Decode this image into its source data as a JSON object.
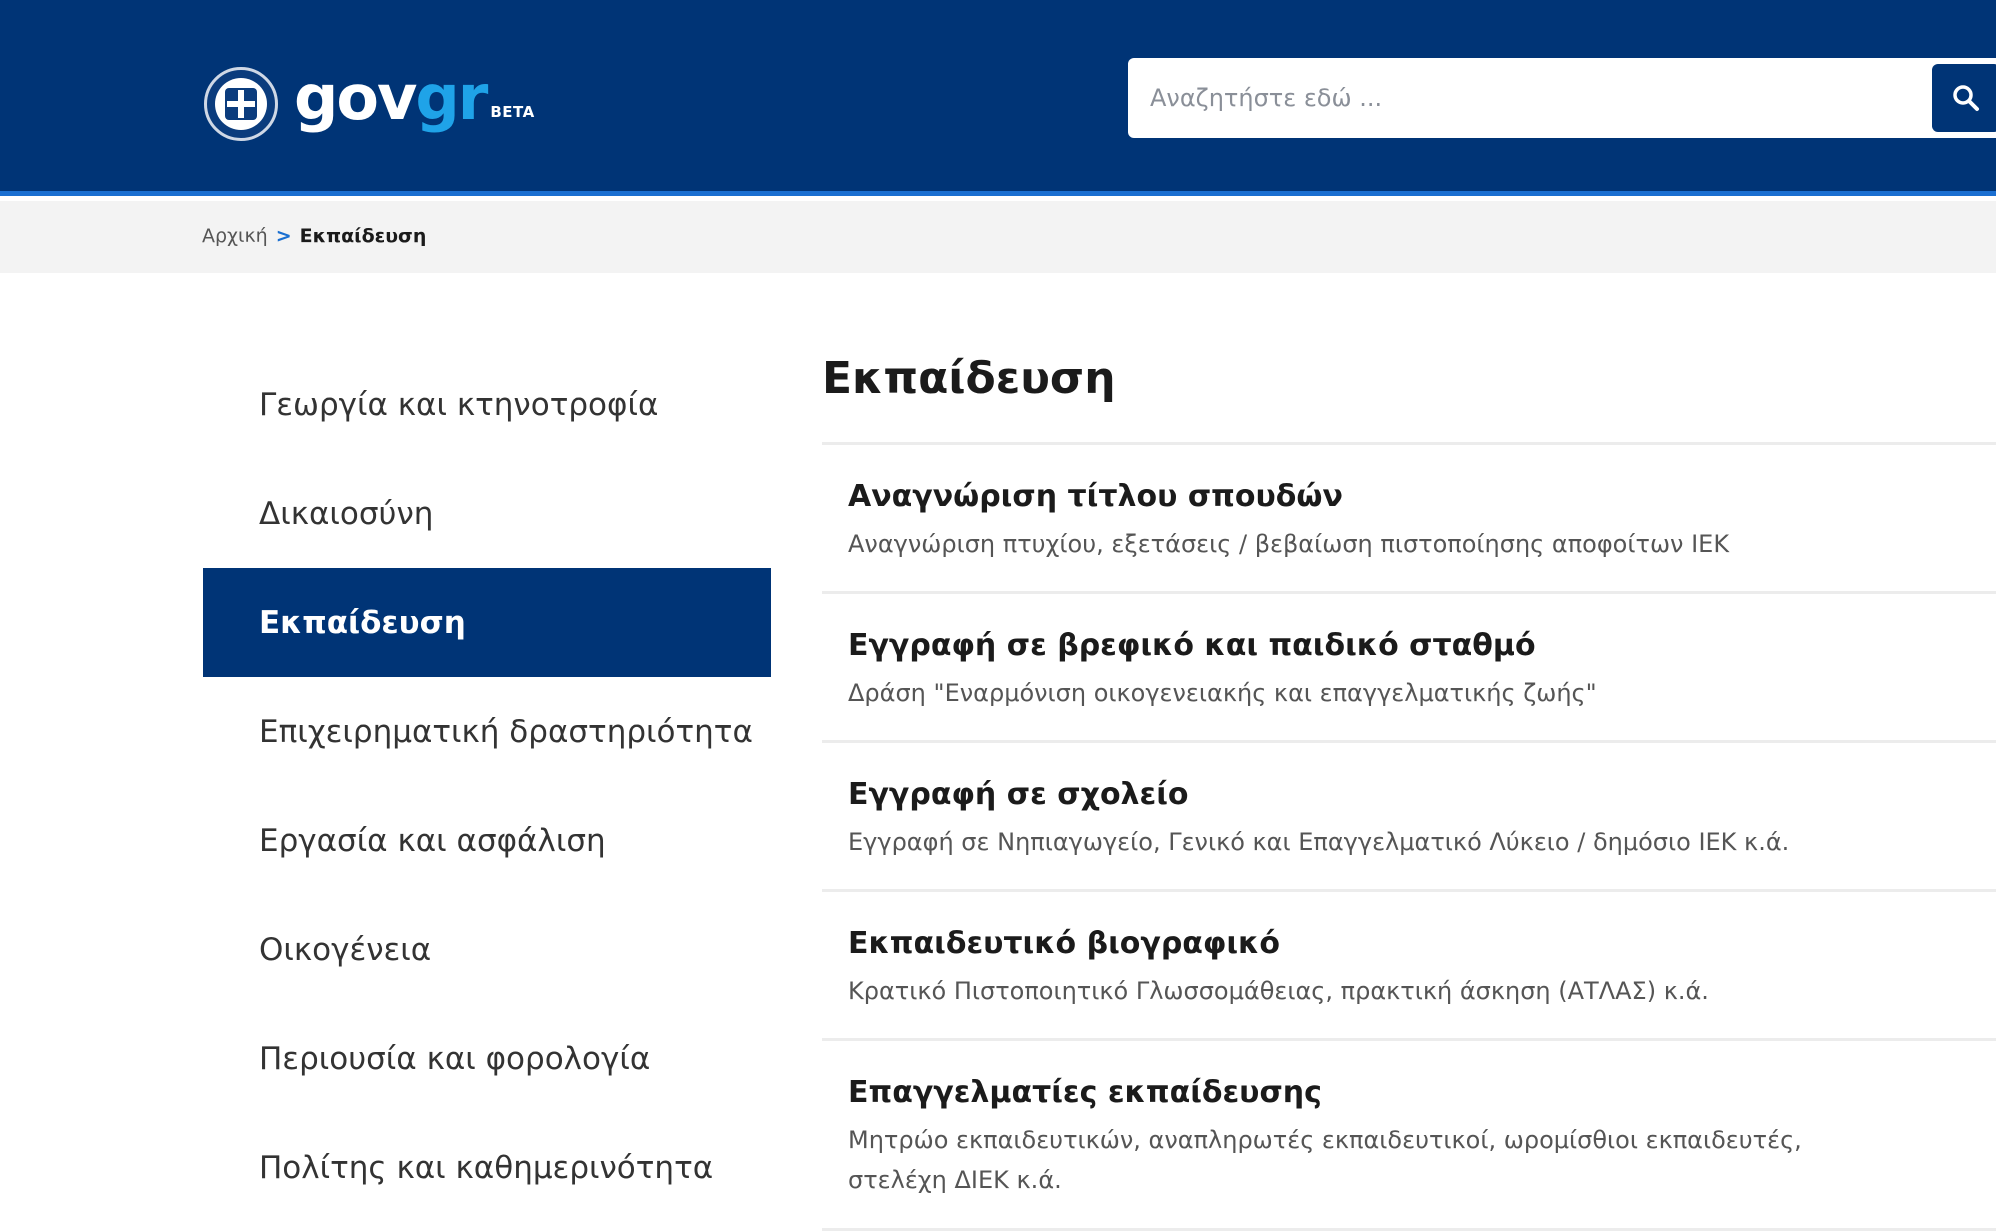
{
  "header": {
    "logo_main": "gov",
    "logo_accent": "gr",
    "logo_badge": "BETA",
    "search": {
      "placeholder": "Αναζητήστε εδώ ...",
      "icon": "search-icon"
    }
  },
  "breadcrumb": {
    "home": "Αρχική",
    "separator": ">",
    "current": "Εκπαίδευση"
  },
  "sidebar": {
    "items": [
      {
        "label": "Γεωργία και κτηνοτροφία",
        "active": false
      },
      {
        "label": "Δικαιοσύνη",
        "active": false
      },
      {
        "label": "Εκπαίδευση",
        "active": true
      },
      {
        "label": "Επιχειρηματική δραστηριότητα",
        "active": false
      },
      {
        "label": "Εργασία και ασφάλιση",
        "active": false
      },
      {
        "label": "Οικογένεια",
        "active": false
      },
      {
        "label": "Περιουσία και φορολογία",
        "active": false
      },
      {
        "label": "Πολίτης και καθημερινότητα",
        "active": false
      }
    ]
  },
  "main": {
    "title": "Εκπαίδευση",
    "services": [
      {
        "title": "Αναγνώριση τίτλου σπουδών",
        "description": "Αναγνώριση πτυχίου, εξετάσεις / βεβαίωση πιστοποίησης αποφοίτων ΙΕΚ"
      },
      {
        "title": "Εγγραφή σε βρεφικό και παιδικό σταθμό",
        "description": "Δράση \"Εναρμόνιση οικογενειακής και επαγγελματικής ζωής\""
      },
      {
        "title": "Εγγραφή σε σχολείο",
        "description": "Εγγραφή σε Νηπιαγωγείο, Γενικό και Επαγγελματικό Λύκειο / δημόσιο ΙΕΚ κ.ά."
      },
      {
        "title": "Εκπαιδευτικό βιογραφικό",
        "description": "Κρατικό Πιστοποιητικό Γλωσσομάθειας, πρακτική άσκηση (ΑΤΛΑΣ) κ.ά."
      },
      {
        "title": "Επαγγελματίες εκπαίδευσης",
        "description": "Μητρώο εκπαιδευτικών, αναπληρωτές εκπαιδευτικοί, ωρομίσθιοι εκπαιδευτές, στελέχη ΔΙΕΚ κ.ά."
      }
    ]
  },
  "colors": {
    "primary": "#003476",
    "accent": "#1fa3e8",
    "header_border": "#1a6fd1",
    "breadcrumb_bg": "#f3f3f3"
  }
}
